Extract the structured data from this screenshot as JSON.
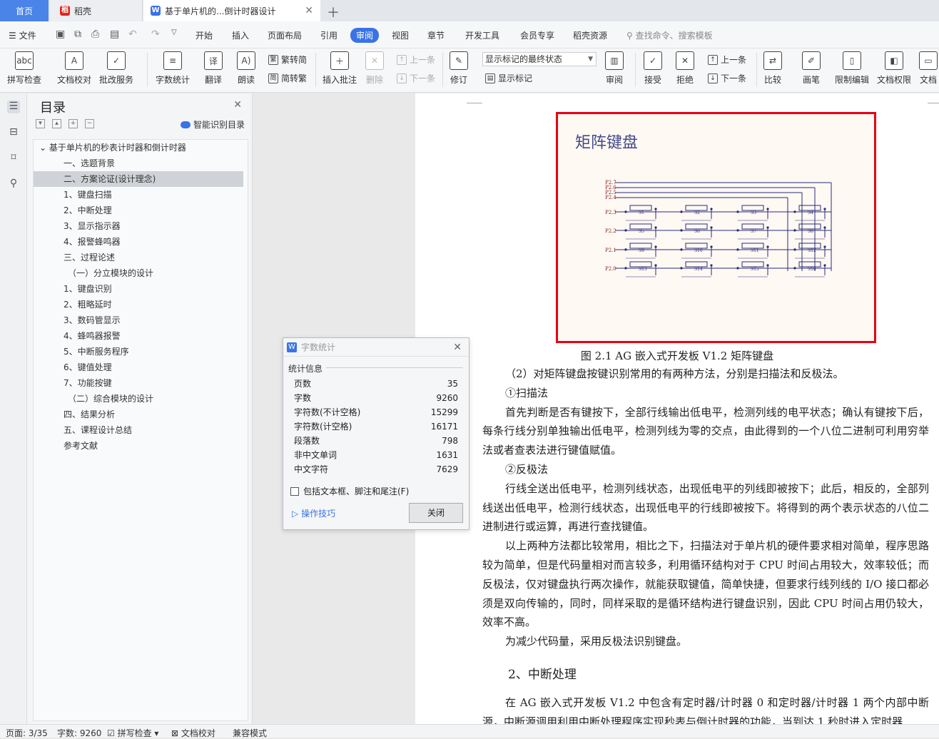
{
  "tabs": {
    "home": "首页",
    "daoke": "稻壳",
    "doc": "基于单片机的...倒计时器设计",
    "doc_icon": "W"
  },
  "menu": {
    "file": "文件",
    "items": [
      "开始",
      "插入",
      "页面布局",
      "引用",
      "审阅",
      "视图",
      "章节",
      "开发工具",
      "会员专享",
      "稻壳资源"
    ],
    "active": "审阅",
    "search": "查找命令、搜索模板"
  },
  "ribbon": {
    "spell": "拼写检查",
    "proof": "文档校对",
    "batch": "批改服务",
    "wordcount": "字数统计",
    "translate": "翻译",
    "read": "朗读",
    "trad": "繁转简",
    "simp": "简转繁",
    "insert_comment": "插入批注",
    "delete": "删除",
    "prev": "上一条",
    "next": "下一条",
    "revise": "修订",
    "markup_state": "显示标记的最终状态",
    "show_markup": "显示标记",
    "review": "审阅",
    "accept": "接受",
    "reject": "拒绝",
    "prev2": "上一条",
    "next2": "下一条",
    "compare": "比较",
    "pen": "画笔",
    "restrict": "限制编辑",
    "perm": "文档权限",
    "more": "文档"
  },
  "toc": {
    "title": "目录",
    "smart": "智能识别目录",
    "items": [
      {
        "label": "基于单片机的秒表计时器和倒计时器",
        "level": 0
      },
      {
        "label": "一、选题背景",
        "level": 1
      },
      {
        "label": "二、方案论证(设计理念)",
        "level": 1,
        "selected": true
      },
      {
        "label": "1、键盘扫描",
        "level": 1
      },
      {
        "label": "2、中断处理",
        "level": 1
      },
      {
        "label": "3、显示指示器",
        "level": 1
      },
      {
        "label": "4、报警蜂鸣器",
        "level": 1
      },
      {
        "label": "三、过程论述",
        "level": 1
      },
      {
        "label": "（一）分立模块的设计",
        "level": 2
      },
      {
        "label": "1、键盘识别",
        "level": 1
      },
      {
        "label": "2、粗略延时",
        "level": 1
      },
      {
        "label": "3、数码管显示",
        "level": 1
      },
      {
        "label": "4、蜂鸣器报警",
        "level": 1
      },
      {
        "label": "5、中断服务程序",
        "level": 1
      },
      {
        "label": "6、键值处理",
        "level": 1
      },
      {
        "label": "7、功能按键",
        "level": 1
      },
      {
        "label": "（二）综合模块的设计",
        "level": 2
      },
      {
        "label": "四、结果分析",
        "level": 1
      },
      {
        "label": "五、课程设计总结",
        "level": 1
      },
      {
        "label": "参考文献",
        "level": 1
      }
    ]
  },
  "figure": {
    "title": "矩阵键盘",
    "caption": "图 2.1 AG 嵌入式开发板 V1.2 矩阵键盘",
    "cols": [
      "P2.7",
      "P2.6",
      "P2.5",
      "P2.4"
    ],
    "rows": [
      "P2.3",
      "P2.2",
      "P2.1",
      "P2.0"
    ],
    "keys": [
      "S1",
      "S2",
      "S3",
      "S4",
      "S5",
      "S6",
      "S7",
      "S8",
      "S9",
      "S10",
      "S11",
      "S12",
      "S13",
      "S14",
      "S15",
      "S16"
    ]
  },
  "document": {
    "paragraphs": [
      {
        "text": "（2）对矩阵键盘按键识别常用的有两种方法，分别是扫描法和反极法。",
        "indent": true
      },
      {
        "text": "①扫描法",
        "indent": true
      },
      {
        "text": "首先判断是否有键按下，全部行线输出低电平，检测列线的电平状态；确认有键按下后，每条行线分别单独输出低电平，检测列线为零的交点，由此得到的一个八位二进制可利用穷举法或者查表法进行键值赋值。",
        "indent": true
      },
      {
        "text": "②反极法",
        "indent": true
      },
      {
        "text": "行线全送出低电平，检测列线状态，出现低电平的列线即被按下；此后，相反的，全部列线送出低电平，检测行线状态，出现低电平的行线即被按下。将得到的两个表示状态的八位二进制进行或运算，再进行查找键值。",
        "indent": true
      },
      {
        "text": "以上两种方法都比较常用，相比之下，扫描法对于单片机的硬件要求相对简单，程序思路较为简单，但是代码量相对而言较多，利用循环结构对于 CPU 时间占用较大，效率较低；而反极法，仅对键盘执行两次操作，就能获取键值，简单快捷，但要求行线列线的 I/O 接口都必须是双向传输的，同时，同样采取的是循环结构进行键盘识别，因此 CPU 时间占用仍较大，效率不高。",
        "indent": true
      },
      {
        "text": "为减少代码量，采用反极法识别键盘。",
        "indent": true
      }
    ],
    "heading": "2、中断处理",
    "last": "在 AG 嵌入式开发板 V1.2 中包含有定时器/计时器 0 和定时器/计时器 1 两个内部中断源，中断源调用利用中断处理程序实现秒表与倒计时器的功能，当到达 1 秒时进入定时器"
  },
  "dialog": {
    "title": "字数统计",
    "section": "统计信息",
    "rows": [
      {
        "label": "页数",
        "value": "35"
      },
      {
        "label": "字数",
        "value": "9260"
      },
      {
        "label": "字符数(不计空格)",
        "value": "15299"
      },
      {
        "label": "字符数(计空格)",
        "value": "16171"
      },
      {
        "label": "段落数",
        "value": "798"
      },
      {
        "label": "非中文单词",
        "value": "1631"
      },
      {
        "label": "中文字符",
        "value": "7629"
      }
    ],
    "checkbox": "包括文本框、脚注和尾注(F)",
    "tips": "操作技巧",
    "close": "关闭"
  },
  "status": {
    "page": "页面: 3/35",
    "words": "字数: 9260",
    "spell": "拼写检查",
    "proof": "文档校对",
    "compat": "兼容模式"
  },
  "colors": {
    "accent": "#3a73e6",
    "figure_border": "#e60012"
  }
}
